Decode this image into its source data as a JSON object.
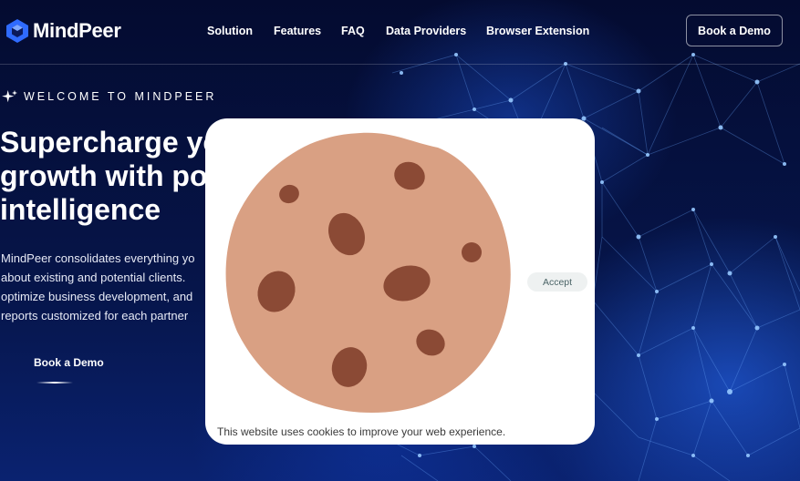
{
  "brand": {
    "name": "MindPeer",
    "logo_icon": "hexagon-cube-icon"
  },
  "nav": {
    "items": [
      {
        "label": "Solution"
      },
      {
        "label": "Features"
      },
      {
        "label": "FAQ"
      },
      {
        "label": "Data Providers"
      },
      {
        "label": "Browser Extension"
      }
    ],
    "cta_label": "Book a Demo"
  },
  "hero": {
    "eyebrow": "WELCOME TO MINDPEER",
    "eyebrow_icon": "sparkle-icon",
    "headline_lines": [
      "Supercharge yo",
      "growth with po",
      "intelligence"
    ],
    "description_lines": [
      "MindPeer consolidates everything yo",
      "about existing and potential clients.",
      "optimize business development, and",
      "reports customized for each partner"
    ],
    "cta_label": "Book a Demo"
  },
  "cookie_modal": {
    "image": "cookie-illustration",
    "accept_label": "Accept",
    "message": "This website uses cookies to improve your web experience."
  },
  "colors": {
    "background": "#030a2e",
    "accent_blue": "#2f6bff",
    "cookie_dough": "#d9a083",
    "cookie_chip": "#8b4a35",
    "accept_bg": "#eef1f1"
  }
}
